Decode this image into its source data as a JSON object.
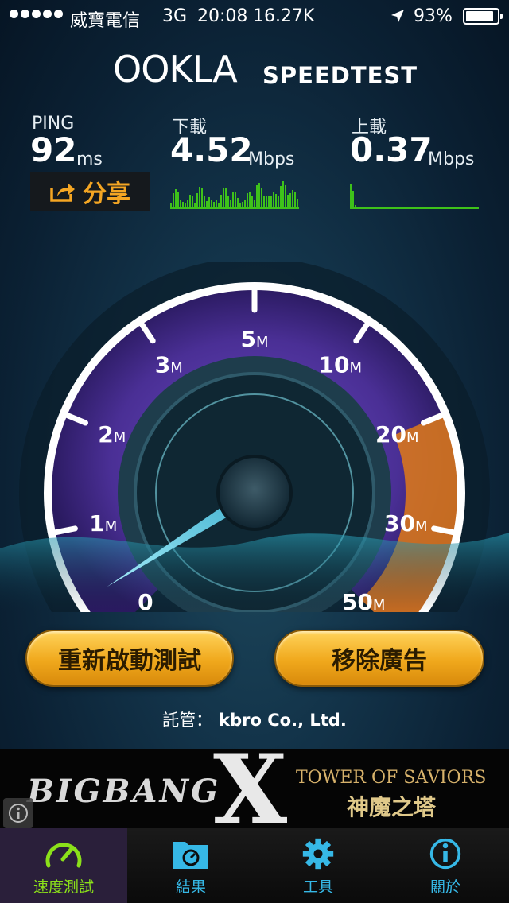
{
  "status_bar": {
    "carrier": "威寶電信",
    "network": "3G",
    "time": "20:08",
    "data_rate": "16.27K",
    "location_icon": "location-arrow-icon",
    "battery_percent": "93%",
    "battery_level": 0.93
  },
  "header": {
    "logo": "OOKLA",
    "title": "SPEEDTEST"
  },
  "results": {
    "ping": {
      "label": "PING",
      "value": "92",
      "unit": "ms"
    },
    "download": {
      "label": "下載",
      "value": "4.52",
      "unit": "Mbps"
    },
    "upload": {
      "label": "上載",
      "value": "0.37",
      "unit": "Mbps"
    },
    "share_label": "分享"
  },
  "gauge": {
    "ticks": [
      {
        "label": "0",
        "unit": ""
      },
      {
        "label": "1",
        "unit": "M"
      },
      {
        "label": "2",
        "unit": "M"
      },
      {
        "label": "3",
        "unit": "M"
      },
      {
        "label": "5",
        "unit": "M"
      },
      {
        "label": "10",
        "unit": "M"
      },
      {
        "label": "20",
        "unit": "M"
      },
      {
        "label": "30",
        "unit": "M"
      },
      {
        "label": "50",
        "unit": "M"
      }
    ],
    "needle_value_mbps": 0.37,
    "colors": {
      "arc": "#ffffff",
      "purple": "#5b3aa8",
      "orange": "#e07a18",
      "needle": "#7fe6ff"
    }
  },
  "actions": {
    "restart_label": "重新啟動測試",
    "remove_ads_label": "移除廣告"
  },
  "host": {
    "label": "託管：",
    "name": "kbro Co., Ltd."
  },
  "ad": {
    "left_text": "BIGBANG",
    "right_top": "TOWER OF SAVIORS",
    "right_bottom": "神魔之塔"
  },
  "tabs": [
    {
      "label": "速度測試",
      "icon": "speedometer-icon",
      "active": true
    },
    {
      "label": "結果",
      "icon": "results-folder-icon",
      "active": false
    },
    {
      "label": "工具",
      "icon": "gear-icon",
      "active": false
    },
    {
      "label": "關於",
      "icon": "info-icon",
      "active": false
    }
  ],
  "colors": {
    "accent_orange": "#f0a81c",
    "tab_active": "#8be01a",
    "tab_inactive": "#36b8e6",
    "graph_green": "#3ec21a"
  }
}
